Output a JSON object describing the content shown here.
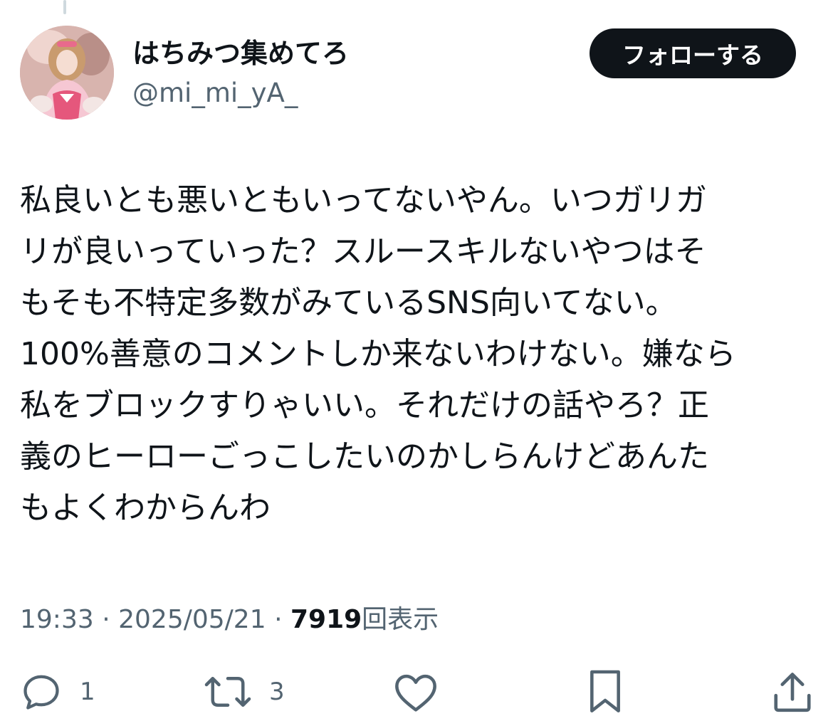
{
  "tweet": {
    "author": {
      "display_name": "はちみつ集めてろ",
      "handle": "@mi_mi_yA_"
    },
    "follow_label": "フォローする",
    "text_lines": [
      "私良いとも悪いともいってないやん。いつガリガ",
      "リが良いっていった？スルースキルないやつはそ",
      "もそも不特定多数がみているSNS向いてない。",
      "100%善意のコメントしか来ないわけない。嫌なら",
      "私をブロックすりゃいい。それだけの話やろ？正",
      "義のヒーローごっこしたいのかしらんけどあんた",
      "もよくわからんわ"
    ],
    "time": "19:33",
    "date": "2025/05/21",
    "separator": "·",
    "view_count": "7919",
    "view_label": "回表示",
    "actions": {
      "reply_icon": "reply-icon",
      "reply_count": "1",
      "retweet_icon": "retweet-icon",
      "retweet_count": "3",
      "like_icon": "heart-icon",
      "bookmark_icon": "bookmark-icon",
      "share_icon": "share-icon"
    }
  },
  "colors": {
    "text_primary": "#0f1419",
    "text_secondary": "#536471",
    "button_bg": "#0f1419",
    "button_text": "#ffffff",
    "thread_line": "#cfd9de"
  }
}
